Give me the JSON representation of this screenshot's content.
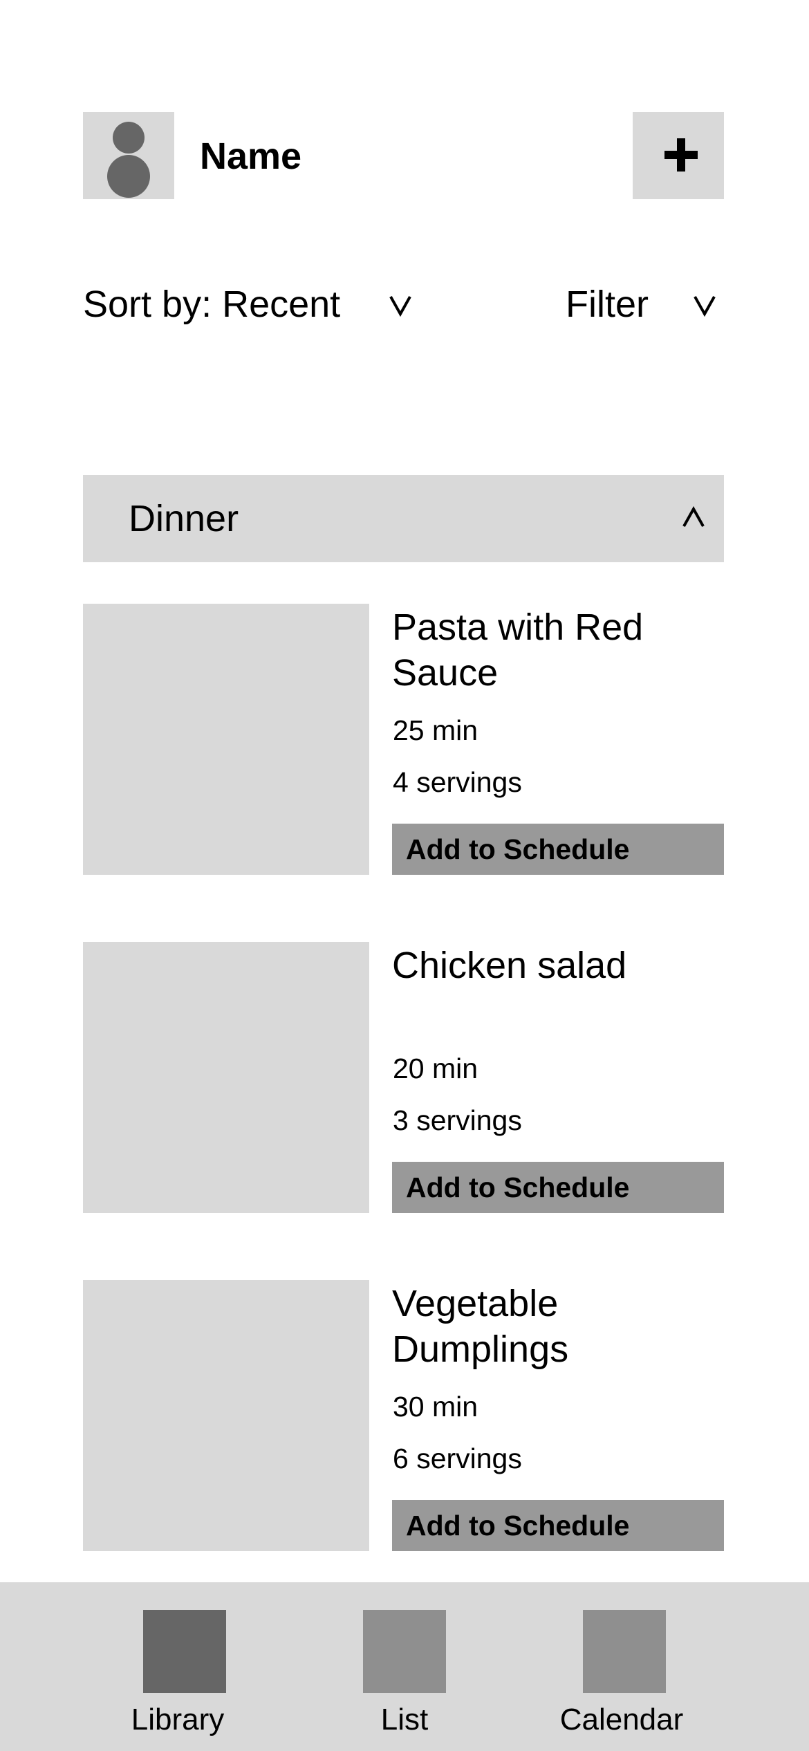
{
  "header": {
    "name": "Name"
  },
  "controls": {
    "sort_label": "Sort by: Recent",
    "filter_label": "Filter"
  },
  "category": {
    "label": "Dinner"
  },
  "recipes": [
    {
      "title": "Pasta with Red Sauce",
      "time": "25 min",
      "servings": "4 servings",
      "action": "Add to Schedule"
    },
    {
      "title": "Chicken salad",
      "time": "20 min",
      "servings": "3 servings",
      "action": "Add to Schedule"
    },
    {
      "title": "Vegetable Dumplings",
      "time": "30 min",
      "servings": "6 servings",
      "action": "Add to Schedule"
    }
  ],
  "nav": {
    "items": [
      {
        "label": "Library",
        "icon": "library-icon",
        "active": true
      },
      {
        "label": "List",
        "icon": "list-icon",
        "active": false
      },
      {
        "label": "Calendar",
        "icon": "calendar-icon",
        "active": false
      }
    ]
  },
  "colors": {
    "placeholder": "#d9d9d9",
    "button": "#999999",
    "active_icon": "#666666",
    "inactive_icon": "#8f8f8f"
  }
}
